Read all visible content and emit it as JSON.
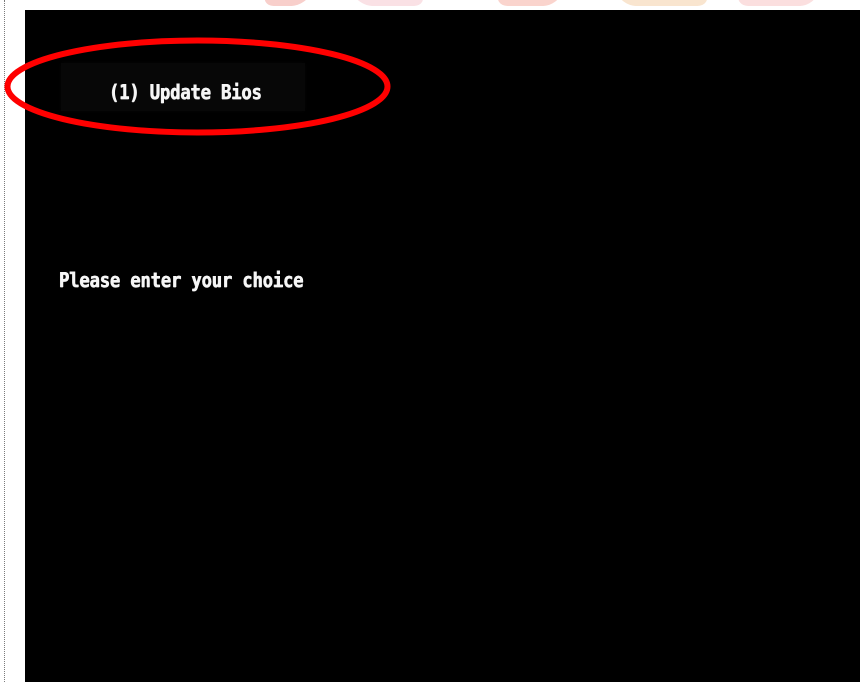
{
  "screen": {
    "menu_option": "(1) Update Bios",
    "prompt": "Please enter your choice"
  },
  "colors": {
    "screen_background": "#000000",
    "terminal_text": "#f6f6f6",
    "annotation": "#ff0000",
    "page_background": "#ffffff"
  },
  "icons": {
    "annotation": "red-ellipse-icon"
  }
}
